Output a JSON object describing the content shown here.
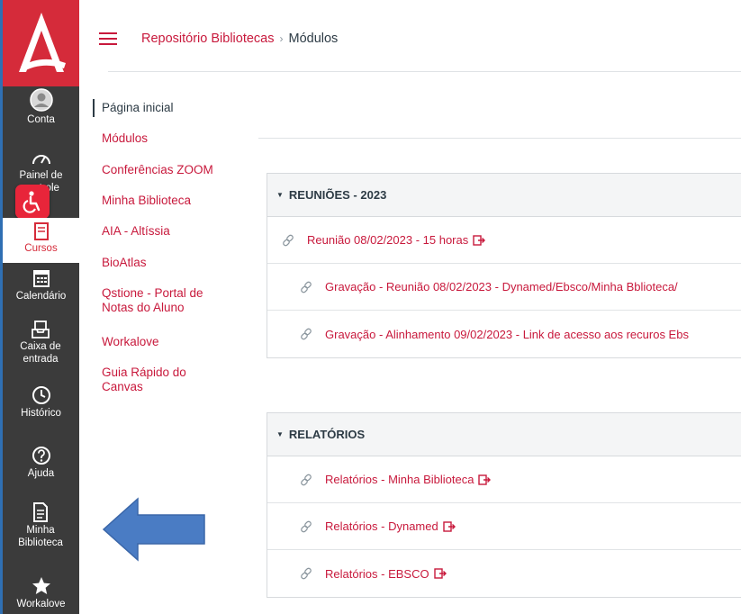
{
  "global_nav": {
    "items": [
      {
        "label": "Conta",
        "icon": "user-avatar-icon"
      },
      {
        "label": "Painel de controle",
        "icon": "dashboard-icon"
      },
      {
        "label": "Cursos",
        "icon": "book-icon"
      },
      {
        "label": "Calendário",
        "icon": "calendar-icon"
      },
      {
        "label": "Caixa de entrada",
        "icon": "inbox-icon"
      },
      {
        "label": "Histórico",
        "icon": "clock-icon"
      },
      {
        "label": "Ajuda",
        "icon": "help-icon"
      },
      {
        "label": "Minha Biblioteca",
        "icon": "document-icon"
      },
      {
        "label": "Workalove",
        "icon": "star-icon"
      }
    ],
    "active": "Cursos"
  },
  "breadcrumb": {
    "course": "Repositório Bibliotecas",
    "separator": "›",
    "current": "Módulos"
  },
  "course_nav": [
    "Página inicial",
    "Módulos",
    "Conferências ZOOM",
    "Minha Biblioteca",
    "AIA - Altíssia",
    "BioAtlas",
    "Qstione - Portal de Notas do Aluno",
    "Workalove",
    "Guia Rápido do Canvas"
  ],
  "modules": [
    {
      "title": "REUNIÕES - 2023",
      "items": [
        {
          "title": "Reunião 08/02/2023 - 15 horas",
          "external": true
        },
        {
          "title": "Gravação - Reunião 08/02/2023 - Dynamed/Ebsco/Minha Bblioteca/",
          "external": false
        },
        {
          "title": "Gravação - Alinhamento 09/02/2023 - Link de acesso aos recuros Ebs",
          "external": false
        }
      ]
    },
    {
      "title": "RELATÓRIOS",
      "items": [
        {
          "title": "Relatórios - Minha Biblioteca",
          "external": true
        },
        {
          "title": "Relatórios - Dynamed",
          "external": true
        },
        {
          "title": "Relatórios - EBSCO",
          "external": true
        }
      ]
    }
  ],
  "colors": {
    "brand": "#d52b3a",
    "link": "#c8193c",
    "nav_bg": "#3b3b3b",
    "arrow": "#4a7cc4"
  }
}
